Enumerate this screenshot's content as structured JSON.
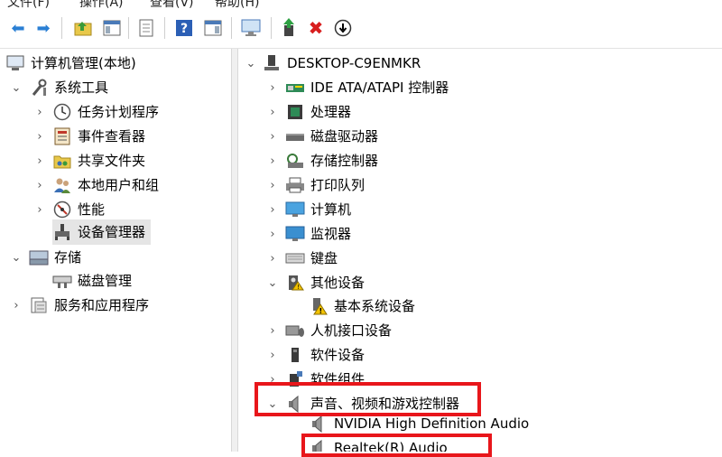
{
  "menu": {
    "items": [
      "文件(F)",
      "操作(A)",
      "查看(V)",
      "帮助(H)"
    ]
  },
  "left_tree": {
    "root": "计算机管理(本地)",
    "system_tools": "系统工具",
    "task_scheduler": "任务计划程序",
    "event_viewer": "事件查看器",
    "shared_folders": "共享文件夹",
    "local_users": "本地用户和组",
    "performance": "性能",
    "device_manager": "设备管理器",
    "storage": "存储",
    "disk_management": "磁盘管理",
    "services": "服务和应用程序"
  },
  "right_tree": {
    "computer": "DESKTOP-C9ENMKR",
    "ide": "IDE ATA/ATAPI 控制器",
    "processor": "处理器",
    "disk_drives": "磁盘驱动器",
    "storage_ctrl": "存储控制器",
    "print_queue": "打印队列",
    "computer_node": "计算机",
    "monitors": "监视器",
    "keyboards": "键盘",
    "other_devices": "其他设备",
    "base_system_device": "基本系统设备",
    "hid": "人机接口设备",
    "software_devices": "软件设备",
    "software_components": "软件组件",
    "sound": "声音、视频和游戏控制器",
    "nvidia_audio": "NVIDIA High Definition Audio",
    "realtek_audio": "Realtek(R) Audio"
  },
  "colors": {
    "highlight": "#e8161b",
    "selection": "#e5e5e5"
  }
}
